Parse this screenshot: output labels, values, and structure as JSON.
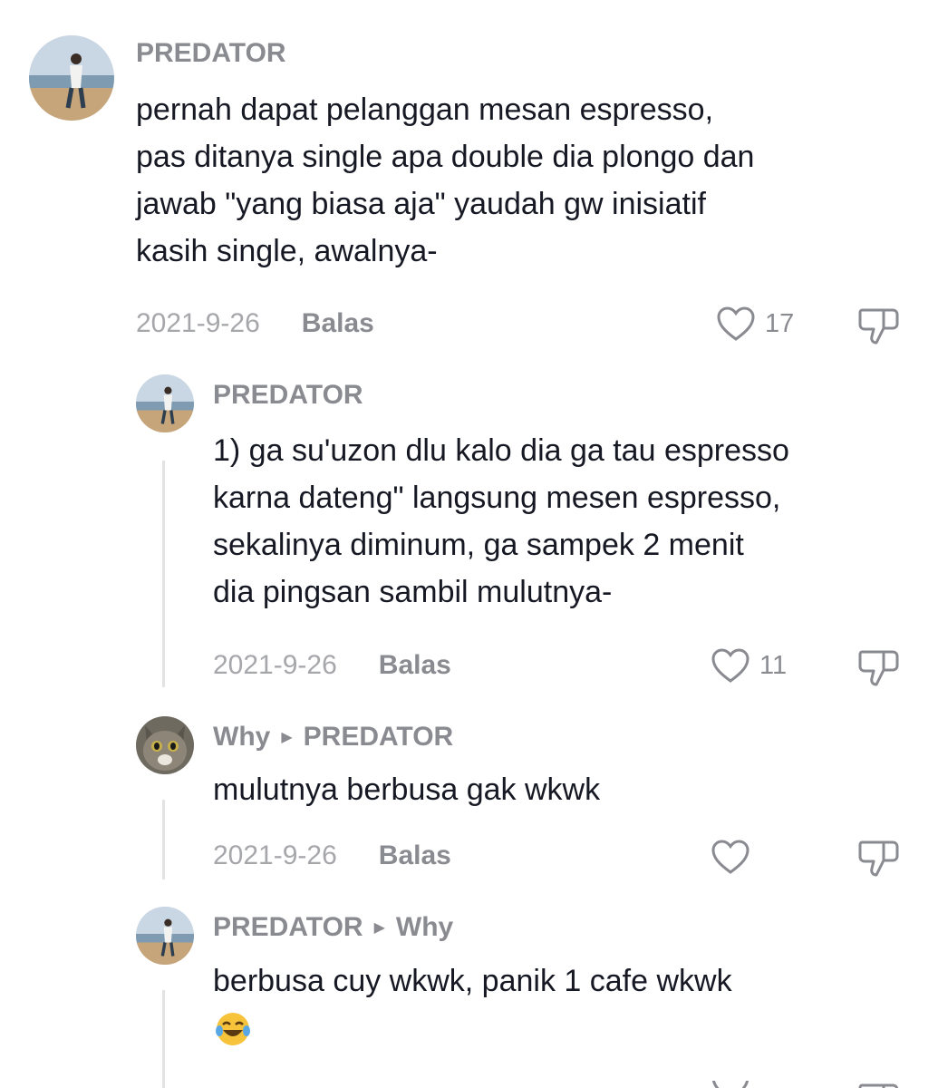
{
  "comments": [
    {
      "user": "PREDATOR",
      "lines": [
        "pernah dapat pelanggan mesan espresso,",
        "pas ditanya single apa double dia plongo dan",
        "jawab \"yang biasa aja\" yaudah gw inisiatif",
        "kasih single, awalnya-"
      ],
      "date": "2021-9-26",
      "reply_label": "Balas",
      "likes": "17"
    },
    {
      "user": "PREDATOR",
      "lines": [
        "1) ga su'uzon dlu kalo dia ga tau espresso",
        "karna dateng\" langsung mesen espresso,",
        "sekalinya diminum, ga sampek 2 menit",
        "dia pingsan sambil mulutnya-"
      ],
      "date": "2021-9-26",
      "reply_label": "Balas",
      "likes": "11"
    },
    {
      "user": "Why",
      "reply_to": "PREDATOR",
      "lines": [
        "mulutnya berbusa gak wkwk"
      ],
      "date": "2021-9-26",
      "reply_label": "Balas",
      "likes": ""
    },
    {
      "user": "PREDATOR",
      "reply_to": "Why",
      "lines": [
        "berbusa cuy wkwk, panik 1 cafe wkwk"
      ],
      "emoji": "face-with-tears-of-joy",
      "date": "",
      "reply_label": "",
      "likes": ""
    }
  ],
  "icons": {
    "like": "heart-outline-icon",
    "dislike": "thumbs-down-outline-icon",
    "reply_arrow": "right-triangle-icon"
  },
  "colors": {
    "username": "#8a8b91",
    "text": "#161823",
    "meta": "#a6a7ab"
  }
}
